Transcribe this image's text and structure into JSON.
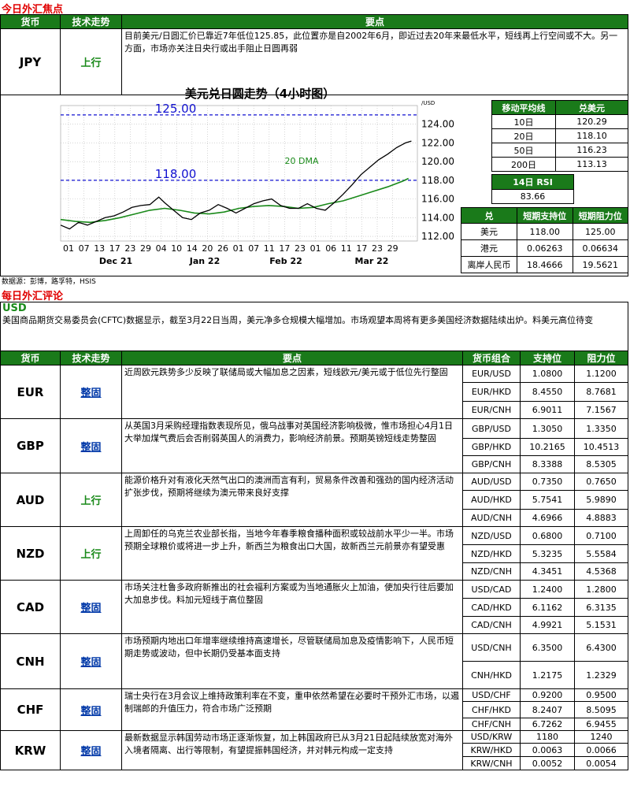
{
  "focus": {
    "title": "今日外汇焦点",
    "headers": [
      "货币",
      "技术走势",
      "要点"
    ],
    "currency": "JPY",
    "trend": "上行",
    "points": "目前美元/日圆汇价已靠近7年低位125.85，此位置亦是自2002年6月，即近过去20年来最低水平，短线再上行空间或不大。另一方面，市场亦关注日央行或出手阻止日圆再弱"
  },
  "chart": {
    "title": "美元兑日圆走势（4小时图）",
    "source": "数据源：彭博，路孚特，HSIS"
  },
  "chart_data": {
    "type": "line",
    "title": "美元兑日圆走势（4小时图）",
    "y_unit": "/USD",
    "ylim": [
      111.5,
      126
    ],
    "yticks": [
      112.0,
      114.0,
      116.0,
      118.0,
      120.0,
      122.0,
      124.0
    ],
    "ytick_labels": [
      "112.00",
      "114.00",
      "116.00",
      "118.00",
      "120.00",
      "122.00",
      "124.00"
    ],
    "xtick_labels": [
      "01",
      "07",
      "13",
      "17",
      "23",
      "29",
      "04",
      "10",
      "14",
      "20",
      "26",
      "01",
      "07",
      "11",
      "17",
      "23",
      "01",
      "06",
      "11",
      "17",
      "23",
      "29"
    ],
    "month_labels": [
      "Dec 21",
      "Jan 22",
      "Feb 22",
      "Mar 22"
    ],
    "hlines": [
      {
        "value": 125.0,
        "label": "125.00"
      },
      {
        "value": 118.0,
        "label": "118.00"
      }
    ],
    "annotation": "20 DMA",
    "series": [
      {
        "name": "20 DMA",
        "color": "#1a8a1a",
        "x": [
          0,
          5,
          10,
          15,
          20,
          25,
          30,
          35,
          40,
          45,
          50,
          55,
          60,
          65,
          70,
          75,
          80,
          85,
          90,
          95,
          100,
          105,
          110,
          115,
          117
        ],
        "y": [
          113.8,
          113.6,
          113.5,
          113.7,
          114.0,
          114.4,
          114.8,
          115.0,
          114.8,
          114.5,
          114.4,
          114.6,
          115.0,
          115.2,
          115.3,
          115.2,
          115.0,
          115.1,
          115.5,
          115.8,
          116.3,
          116.8,
          117.3,
          117.9,
          118.2
        ]
      },
      {
        "name": "USD/JPY",
        "color": "#000000",
        "x": [
          0,
          3,
          6,
          9,
          12,
          15,
          18,
          21,
          24,
          27,
          30,
          33,
          35,
          38,
          41,
          44,
          47,
          50,
          53,
          56,
          59,
          62,
          65,
          68,
          71,
          74,
          77,
          80,
          83,
          86,
          89,
          92,
          95,
          98,
          101,
          104,
          107,
          110,
          113,
          116,
          118
        ],
        "y": [
          113.2,
          112.8,
          113.5,
          113.2,
          113.6,
          114.0,
          114.2,
          114.6,
          115.1,
          115.3,
          115.4,
          116.2,
          115.6,
          114.8,
          114.0,
          113.8,
          114.5,
          114.8,
          115.4,
          115.0,
          114.5,
          115.0,
          115.5,
          115.8,
          116.0,
          115.3,
          115.0,
          115.0,
          115.5,
          115.0,
          114.8,
          115.6,
          116.5,
          117.5,
          118.6,
          119.4,
          120.2,
          120.8,
          121.5,
          122.0,
          122.2
        ]
      }
    ]
  },
  "ma_table": {
    "headers": [
      "移动平均线",
      "兑美元"
    ],
    "rows": [
      [
        "10日",
        "120.29"
      ],
      [
        "20日",
        "118.10"
      ],
      [
        "50日",
        "116.23"
      ],
      [
        "200日",
        "113.13"
      ]
    ],
    "rsi_label": "14日 RSI",
    "rsi_value": "83.66"
  },
  "sr_table": {
    "headers": [
      "兑",
      "短期支持位",
      "短期阻力位"
    ],
    "rows": [
      [
        "美元",
        "118.00",
        "125.00"
      ],
      [
        "港元",
        "0.06263",
        "0.06634"
      ],
      [
        "离岸人民币",
        "18.4666",
        "19.5621"
      ]
    ]
  },
  "review": {
    "title": "每日外汇评论",
    "usd_label": "USD",
    "usd_text": "美国商品期货交易委员会(CFTC)数据显示，截至3月22日当周，美元净多仓规模大幅增加。市场观望本周将有更多美国经济数据陆续出炉。料美元高位待变",
    "headers": [
      "货币",
      "技术走势",
      "要点",
      "货币组合",
      "支持位",
      "阻力位"
    ],
    "rows": [
      {
        "ccy": "EUR",
        "trend": "整固",
        "up": false,
        "text": "近周欧元跌势多少反映了联储局或大幅加息之因素，短线欧元/美元或于低位先行整固",
        "pairs": [
          [
            "EUR/USD",
            "1.0800",
            "1.1200"
          ],
          [
            "EUR/HKD",
            "8.4550",
            "8.7681"
          ],
          [
            "EUR/CNH",
            "6.9011",
            "7.1567"
          ]
        ]
      },
      {
        "ccy": "GBP",
        "trend": "整固",
        "up": false,
        "text": "从英国3月采购经理指数表现所见，俄乌战事对英国经济影响极微，惟市场担心4月1日大举加煤气费后会否削弱英国人的消费力，影响经济前景。预期英镑短线走势整固",
        "pairs": [
          [
            "GBP/USD",
            "1.3050",
            "1.3350"
          ],
          [
            "GBP/HKD",
            "10.2165",
            "10.4513"
          ],
          [
            "GBP/CNH",
            "8.3388",
            "8.5305"
          ]
        ]
      },
      {
        "ccy": "AUD",
        "trend": "上行",
        "up": true,
        "text": "能源价格升对有液化天然气出口的澳洲而言有利，贸易条件改善和强劲的国内经济活动扩张步伐，预期将继续为澳元带来良好支撑",
        "pairs": [
          [
            "AUD/USD",
            "0.7350",
            "0.7650"
          ],
          [
            "AUD/HKD",
            "5.7541",
            "5.9890"
          ],
          [
            "AUD/CNH",
            "4.6966",
            "4.8883"
          ]
        ]
      },
      {
        "ccy": "NZD",
        "trend": "上行",
        "up": true,
        "text": "上周卸任的乌克兰农业部长指，当地今年春季粮食播种面积或较战前水平少一半。市场预期全球粮价或将进一步上升，新西兰为粮食出口大国，故新西兰元前景亦有望受惠",
        "pairs": [
          [
            "NZD/USD",
            "0.6800",
            "0.7100"
          ],
          [
            "NZD/HKD",
            "5.3235",
            "5.5584"
          ],
          [
            "NZD/CNH",
            "4.3451",
            "4.5368"
          ]
        ]
      },
      {
        "ccy": "CAD",
        "trend": "整固",
        "up": false,
        "text": "市场关注杜鲁多政府新推出的社会福利方案或为当地通胀火上加油，使加央行往后要加大加息步伐。料加元短线于高位整固",
        "pairs": [
          [
            "USD/CAD",
            "1.2400",
            "1.2800"
          ],
          [
            "CAD/HKD",
            "6.1162",
            "6.3135"
          ],
          [
            "CAD/CNH",
            "4.9921",
            "5.1531"
          ]
        ]
      },
      {
        "ccy": "CNH",
        "trend": "整固",
        "up": false,
        "text": "市场预期内地出口年增率继续维持高速增长，尽管联储局加息及疫情影响下，人民币短期走势或波动，但中长期仍受基本面支持",
        "pairs": [
          [
            "USD/CNH",
            "6.3500",
            "6.4300"
          ],
          [
            "CNH/HKD",
            "1.2175",
            "1.2329"
          ]
        ]
      },
      {
        "ccy": "CHF",
        "trend": "整固",
        "up": false,
        "text": "瑞士央行在3月会议上维持政策利率在不变，重申依然希望在必要时干预外汇市场，以遏制瑞郎的升值压力，符合市场广泛预期",
        "pairs": [
          [
            "USD/CHF",
            "0.9200",
            "0.9500"
          ],
          [
            "CHF/HKD",
            "8.2407",
            "8.5095"
          ],
          [
            "CHF/CNH",
            "6.7262",
            "6.9455"
          ]
        ]
      },
      {
        "ccy": "KRW",
        "trend": "整固",
        "up": false,
        "text": "最新数据显示韩国劳动市场正逐渐恢复，加上韩国政府已从3月21日起陆续放宽对海外入境者隔离、出行等限制，有望提振韩国经济，并对韩元构成一定支持",
        "pairs": [
          [
            "USD/KRW",
            "1180",
            "1240"
          ],
          [
            "KRW/HKD",
            "0.0063",
            "0.0066"
          ],
          [
            "KRW/CNH",
            "0.0052",
            "0.0054"
          ]
        ]
      }
    ]
  }
}
